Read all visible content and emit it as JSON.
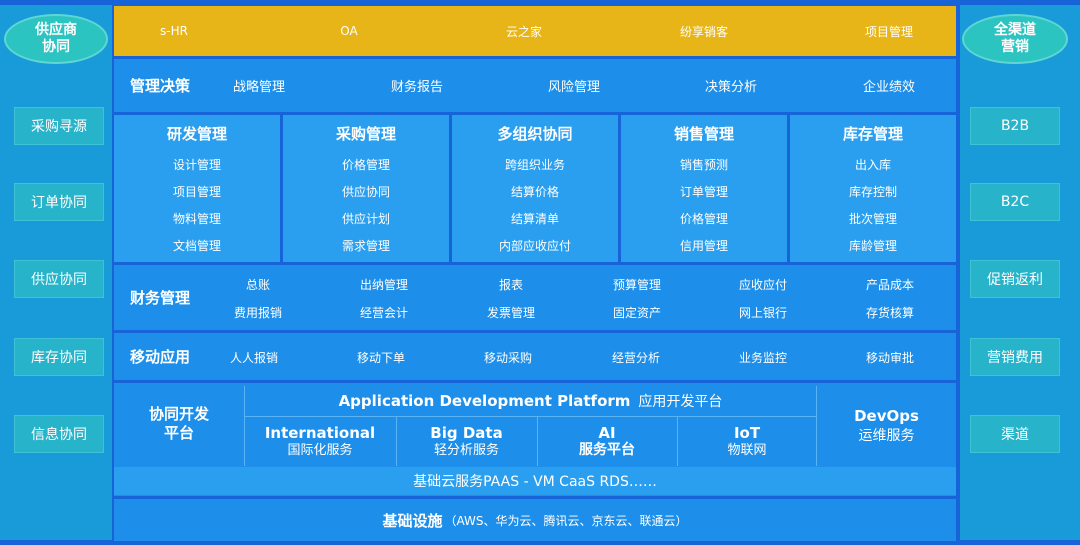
{
  "left_side": {
    "header": "供应商\n协同",
    "items": [
      "采购寻源",
      "订单协同",
      "供应协同",
      "库存协同",
      "信息协同"
    ]
  },
  "right_side": {
    "header": "全渠道\n营销",
    "items": [
      "B2B",
      "B2C",
      "促销返利",
      "营销费用",
      "渠道"
    ]
  },
  "top_bar": [
    "s-HR",
    "OA",
    "云之家",
    "纷享销客",
    "项目管理"
  ],
  "management": {
    "title": "管理决策",
    "items": [
      "战略管理",
      "财务报告",
      "风险管理",
      "决策分析",
      "企业绩效"
    ]
  },
  "modules": [
    {
      "title": "研发管理",
      "items": [
        "设计管理",
        "项目管理",
        "物料管理",
        "文档管理"
      ]
    },
    {
      "title": "采购管理",
      "items": [
        "价格管理",
        "供应协同",
        "供应计划",
        "需求管理"
      ]
    },
    {
      "title": "多组织协同",
      "items": [
        "跨组织业务",
        "结算价格",
        "结算清单",
        "内部应收应付"
      ]
    },
    {
      "title": "销售管理",
      "items": [
        "销售预测",
        "订单管理",
        "价格管理",
        "信用管理"
      ]
    },
    {
      "title": "库存管理",
      "items": [
        "出入库",
        "库存控制",
        "批次管理",
        "库龄管理"
      ]
    }
  ],
  "finance": {
    "title": "财务管理",
    "row1": [
      "总账",
      "出纳管理",
      "报表",
      "预算管理",
      "应收应付",
      "产品成本"
    ],
    "row2": [
      "费用报销",
      "经营会计",
      "发票管理",
      "固定资产",
      "网上银行",
      "存货核算"
    ]
  },
  "mobile": {
    "title": "移动应用",
    "items": [
      "人人报销",
      "移动下单",
      "移动采购",
      "经营分析",
      "业务监控",
      "移动审批"
    ]
  },
  "platform": {
    "left_title": "协同开发\n平台",
    "header_en": "Application Development Platform",
    "header_cn": "应用开发平台",
    "subs": [
      {
        "en": "International",
        "cn": "国际化服务"
      },
      {
        "en": "Big Data",
        "cn": "轻分析服务"
      },
      {
        "en": "AI",
        "cn": "服务平台"
      },
      {
        "en": "IoT",
        "cn": "物联网"
      }
    ],
    "devops_en": "DevOps",
    "devops_cn": "运维服务",
    "paas": "基础云服务PAAS - VM  CaaS  RDS……"
  },
  "infra": {
    "title": "基础设施",
    "detail": "（AWS、华为云、腾讯云、京东云、联通云）"
  },
  "colors": {
    "background": "#1664d8",
    "top_bar": "#e8b519",
    "side_column": "#1a9bd9",
    "side_item": "#27b3c9",
    "module": "#2a9ff0"
  }
}
